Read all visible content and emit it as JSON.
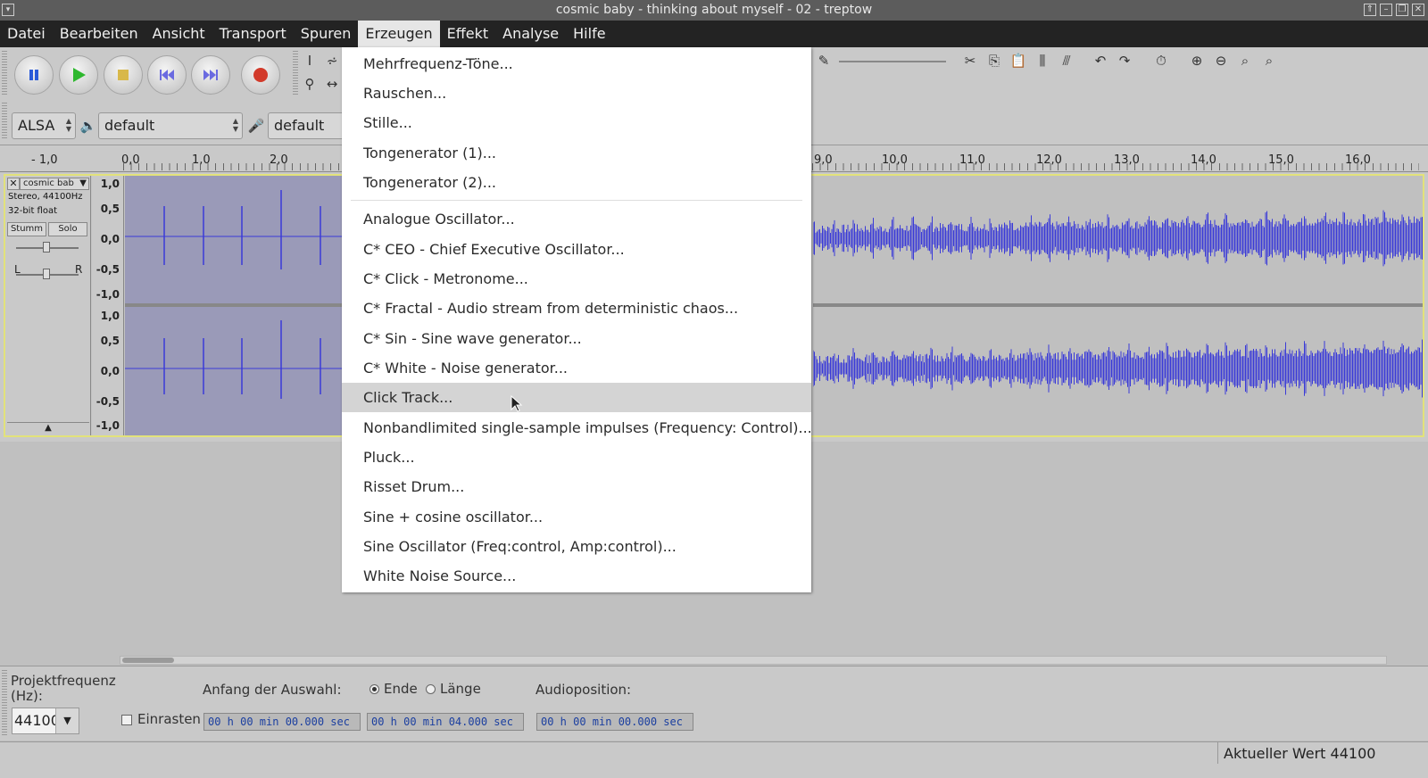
{
  "window": {
    "title": "cosmic baby - thinking about myself - 02 - treptow"
  },
  "menubar": {
    "items": [
      "Datei",
      "Bearbeiten",
      "Ansicht",
      "Transport",
      "Spuren",
      "Erzeugen",
      "Effekt",
      "Analyse",
      "Hilfe"
    ],
    "active": "Erzeugen"
  },
  "devices": {
    "host": "ALSA",
    "playback": "default",
    "recording": "default"
  },
  "ruler": {
    "labels": [
      "- 1,0",
      "0,0",
      "1,0",
      "2,0",
      "9,0",
      "10,0",
      "11,0",
      "12,0",
      "13,0",
      "14,0",
      "15,0",
      "16,0"
    ]
  },
  "track": {
    "name": "cosmic bab",
    "info1": "Stereo, 44100Hz",
    "info2": "32-bit float",
    "mute": "Stumm",
    "solo": "Solo",
    "pan_left": "L",
    "pan_right": "R",
    "scale_top": [
      "1,0",
      "0,5",
      "0,0",
      "-0,5",
      "-1,0"
    ],
    "scale_bottom": [
      "1,0",
      "0,5",
      "0,0",
      "-0,5",
      "-1,0"
    ]
  },
  "dropdown": {
    "group1": [
      "Mehrfrequenz-Töne...",
      "Rauschen...",
      "Stille...",
      "Tongenerator (1)...",
      "Tongenerator (2)..."
    ],
    "group2": [
      "Analogue Oscillator...",
      "C* CEO - Chief Executive Oscillator...",
      "C* Click - Metronome...",
      "C* Fractal - Audio stream from deterministic chaos...",
      "C* Sin - Sine wave generator...",
      "C* White - Noise generator...",
      "Click Track...",
      "Nonbandlimited single-sample impulses (Frequency: Control)...",
      "Pluck...",
      "Risset Drum...",
      "Sine + cosine oscillator...",
      "Sine Oscillator (Freq:control, Amp:control)...",
      "White Noise Source..."
    ],
    "highlighted": "Click Track..."
  },
  "selection": {
    "project_rate_label": "Projektfrequenz (Hz):",
    "project_rate_value": "44100",
    "snap_label": "Einrasten",
    "start_label": "Anfang der Auswahl:",
    "end_option": "Ende",
    "length_option": "Länge",
    "audio_position_label": "Audioposition:",
    "start_time": "00 h 00 min 00.000 sec",
    "end_time": "00 h 00 min 04.000 sec",
    "audio_position": "00 h 00 min 00.000 sec"
  },
  "status": {
    "right": "Aktueller Wert 44100"
  },
  "colors": {
    "menubar": "#232323",
    "waveform": "#3a3ad8",
    "track_border": "#e2e27a"
  }
}
